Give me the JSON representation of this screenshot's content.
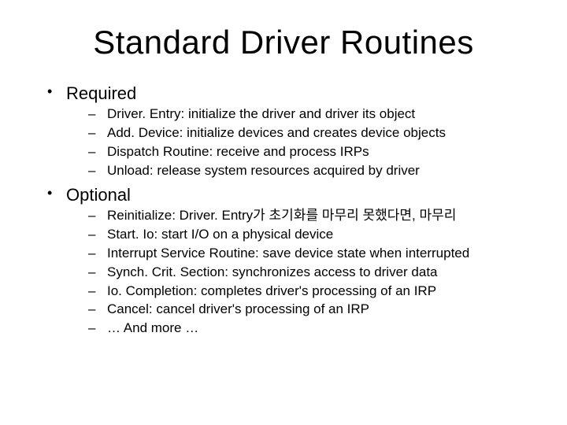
{
  "title": "Standard Driver Routines",
  "sections": [
    {
      "heading": "Required",
      "items": [
        "Driver. Entry: initialize the driver and driver its object",
        "Add. Device: initialize devices and creates device objects",
        "Dispatch Routine: receive and process IRPs",
        "Unload: release system resources acquired by driver"
      ]
    },
    {
      "heading": "Optional",
      "items": [
        "Reinitialize: Driver. Entry가 초기화를 마무리 못했다면, 마무리",
        "Start. Io: start I/O on a physical device",
        "Interrupt Service Routine: save device state when interrupted",
        "Synch. Crit. Section: synchronizes access to driver data",
        "Io. Completion: completes driver's processing of an IRP",
        "Cancel: cancel driver's processing of an IRP",
        "… And more …"
      ]
    }
  ]
}
